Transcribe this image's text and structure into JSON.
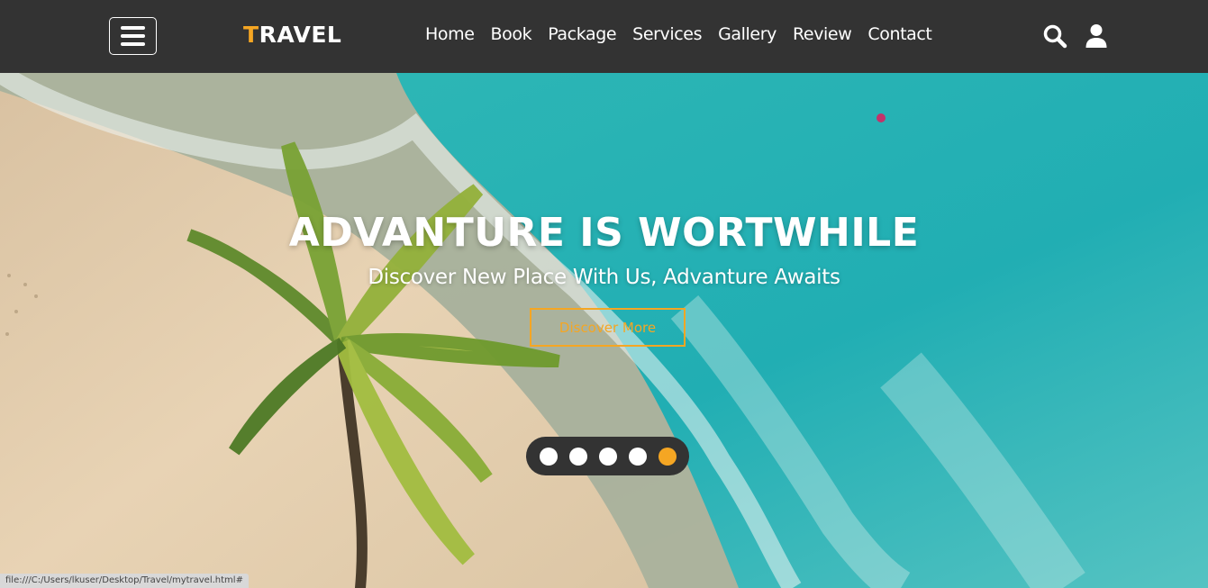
{
  "header": {
    "logo_accent": "T",
    "logo_rest": "RAVEL",
    "nav": [
      "Home",
      "Book",
      "Package",
      "Services",
      "Gallery",
      "Review",
      "Contact"
    ],
    "icons": {
      "menu": "hamburger-menu-icon",
      "search": "search-icon",
      "user": "user-icon"
    }
  },
  "hero": {
    "title": "ADVANTURE IS WORTWHILE",
    "subtitle": "Discover New Place With Us, Advanture Awaits",
    "button_label": "Discover More",
    "slides": 5,
    "active_slide": 5
  },
  "status_url": "file:///C:/Users/lkuser/Desktop/Travel/mytravel.html#",
  "colors": {
    "accent": "#f5a623",
    "header_bg": "#333333",
    "sea": "#27b2b6",
    "sand": "#e6cfad"
  }
}
